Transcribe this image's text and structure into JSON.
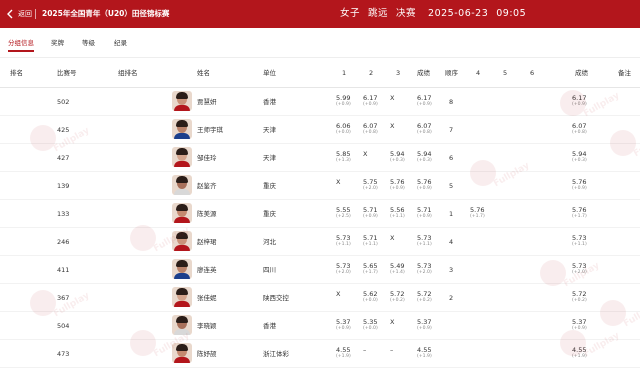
{
  "header": {
    "back_label": "返回",
    "title": "2025年全国青年（U20）田径锦标赛",
    "event_gender": "女子",
    "event_name": "跳远",
    "event_round": "决赛",
    "event_date": "2025-06-23",
    "event_time": "09:05",
    "bg_color": "#b3161c"
  },
  "tabs": [
    "分组信息",
    "奖牌",
    "等级",
    "纪录"
  ],
  "active_tab": "分组信息",
  "columns": {
    "rank": "排名",
    "bib": "比赛号",
    "group": "组排名",
    "name": "姓名",
    "unit": "单位",
    "a1": "1",
    "a2": "2",
    "a3": "3",
    "best3": "成绩",
    "order": "顺序",
    "a4": "4",
    "a5": "5",
    "a6": "6",
    "result": "成绩",
    "note": "备注"
  },
  "watermark_text": "Fullplay",
  "rows": [
    {
      "bib": "502",
      "name": "贾慧妍",
      "unit": "香港",
      "a1": {
        "v": "5.99",
        "w": "(+0.9)"
      },
      "a2": {
        "v": "6.17",
        "w": "(+0.9)"
      },
      "a3": {
        "v": "X",
        "w": ""
      },
      "best3": {
        "v": "6.17",
        "w": "(+0.9)"
      },
      "order": "8",
      "a4": {
        "v": "",
        "w": ""
      },
      "a5": {
        "v": "",
        "w": ""
      },
      "a6": {
        "v": "",
        "w": ""
      },
      "result": {
        "v": "6.17",
        "w": "(+0.9)"
      }
    },
    {
      "bib": "425",
      "name": "王师宇琪",
      "unit": "天津",
      "a1": {
        "v": "6.06",
        "w": "(+0.0)"
      },
      "a2": {
        "v": "6.07",
        "w": "(+0.8)"
      },
      "a3": {
        "v": "X",
        "w": ""
      },
      "best3": {
        "v": "6.07",
        "w": "(+0.8)"
      },
      "order": "7",
      "a4": {
        "v": "",
        "w": ""
      },
      "a5": {
        "v": "",
        "w": ""
      },
      "a6": {
        "v": "",
        "w": ""
      },
      "result": {
        "v": "6.07",
        "w": "(+0.8)"
      }
    },
    {
      "bib": "427",
      "name": "邹佳玲",
      "unit": "天津",
      "a1": {
        "v": "5.85",
        "w": "(+1.3)"
      },
      "a2": {
        "v": "X",
        "w": ""
      },
      "a3": {
        "v": "5.94",
        "w": "(+0.3)"
      },
      "best3": {
        "v": "5.94",
        "w": "(+0.3)"
      },
      "order": "6",
      "a4": {
        "v": "",
        "w": ""
      },
      "a5": {
        "v": "",
        "w": ""
      },
      "a6": {
        "v": "",
        "w": ""
      },
      "result": {
        "v": "5.94",
        "w": "(+0.3)"
      }
    },
    {
      "bib": "139",
      "name": "赵鉴齐",
      "unit": "重庆",
      "a1": {
        "v": "X",
        "w": ""
      },
      "a2": {
        "v": "5.75",
        "w": "(+2.0)"
      },
      "a3": {
        "v": "5.76",
        "w": "(+0.9)"
      },
      "best3": {
        "v": "5.76",
        "w": "(+0.9)"
      },
      "order": "5",
      "a4": {
        "v": "",
        "w": ""
      },
      "a5": {
        "v": "",
        "w": ""
      },
      "a6": {
        "v": "",
        "w": ""
      },
      "result": {
        "v": "5.76",
        "w": "(+0.9)"
      }
    },
    {
      "bib": "133",
      "name": "陈美源",
      "unit": "重庆",
      "a1": {
        "v": "5.55",
        "w": "(+2.5)"
      },
      "a2": {
        "v": "5.71",
        "w": "(+0.9)"
      },
      "a3": {
        "v": "5.56",
        "w": "(+1.1)"
      },
      "best3": {
        "v": "5.71",
        "w": "(+0.9)"
      },
      "order": "1",
      "a4": {
        "v": "5.76",
        "w": "(+1.7)"
      },
      "a5": {
        "v": "",
        "w": ""
      },
      "a6": {
        "v": "",
        "w": ""
      },
      "result": {
        "v": "5.76",
        "w": "(+1.7)"
      }
    },
    {
      "bib": "246",
      "name": "赵梓珺",
      "unit": "河北",
      "a1": {
        "v": "5.73",
        "w": "(+1.1)"
      },
      "a2": {
        "v": "5.71",
        "w": "(+1.1)"
      },
      "a3": {
        "v": "X",
        "w": ""
      },
      "best3": {
        "v": "5.73",
        "w": "(+1.1)"
      },
      "order": "4",
      "a4": {
        "v": "",
        "w": ""
      },
      "a5": {
        "v": "",
        "w": ""
      },
      "a6": {
        "v": "",
        "w": ""
      },
      "result": {
        "v": "5.73",
        "w": "(+1.1)"
      }
    },
    {
      "bib": "411",
      "name": "廖连英",
      "unit": "四川",
      "a1": {
        "v": "5.73",
        "w": "(+2.0)"
      },
      "a2": {
        "v": "5.65",
        "w": "(+1.7)"
      },
      "a3": {
        "v": "5.49",
        "w": "(+1.4)"
      },
      "best3": {
        "v": "5.73",
        "w": "(+2.0)"
      },
      "order": "3",
      "a4": {
        "v": "",
        "w": ""
      },
      "a5": {
        "v": "",
        "w": ""
      },
      "a6": {
        "v": "",
        "w": ""
      },
      "result": {
        "v": "5.73",
        "w": "(+2.0)"
      }
    },
    {
      "bib": "367",
      "name": "张佳妮",
      "unit": "陕西交控",
      "a1": {
        "v": "X",
        "w": ""
      },
      "a2": {
        "v": "5.62",
        "w": "(+0.0)"
      },
      "a3": {
        "v": "5.72",
        "w": "(+0.2)"
      },
      "best3": {
        "v": "5.72",
        "w": "(+0.2)"
      },
      "order": "2",
      "a4": {
        "v": "",
        "w": ""
      },
      "a5": {
        "v": "",
        "w": ""
      },
      "a6": {
        "v": "",
        "w": ""
      },
      "result": {
        "v": "5.72",
        "w": "(+0.2)"
      }
    },
    {
      "bib": "504",
      "name": "李晓颖",
      "unit": "香港",
      "a1": {
        "v": "5.37",
        "w": "(+0.9)"
      },
      "a2": {
        "v": "5.35",
        "w": "(+0.0)"
      },
      "a3": {
        "v": "X",
        "w": ""
      },
      "best3": {
        "v": "5.37",
        "w": "(+0.9)"
      },
      "order": "",
      "a4": {
        "v": "",
        "w": ""
      },
      "a5": {
        "v": "",
        "w": ""
      },
      "a6": {
        "v": "",
        "w": ""
      },
      "result": {
        "v": "5.37",
        "w": "(+0.9)"
      }
    },
    {
      "bib": "473",
      "name": "陈妤颉",
      "unit": "浙江体彩",
      "a1": {
        "v": "4.55",
        "w": "(+1.9)"
      },
      "a2": {
        "v": "–",
        "w": ""
      },
      "a3": {
        "v": "–",
        "w": ""
      },
      "best3": {
        "v": "4.55",
        "w": "(+1.9)"
      },
      "order": "",
      "a4": {
        "v": "",
        "w": ""
      },
      "a5": {
        "v": "",
        "w": ""
      },
      "a6": {
        "v": "",
        "w": ""
      },
      "result": {
        "v": "4.55",
        "w": "(+1.9)"
      }
    }
  ]
}
